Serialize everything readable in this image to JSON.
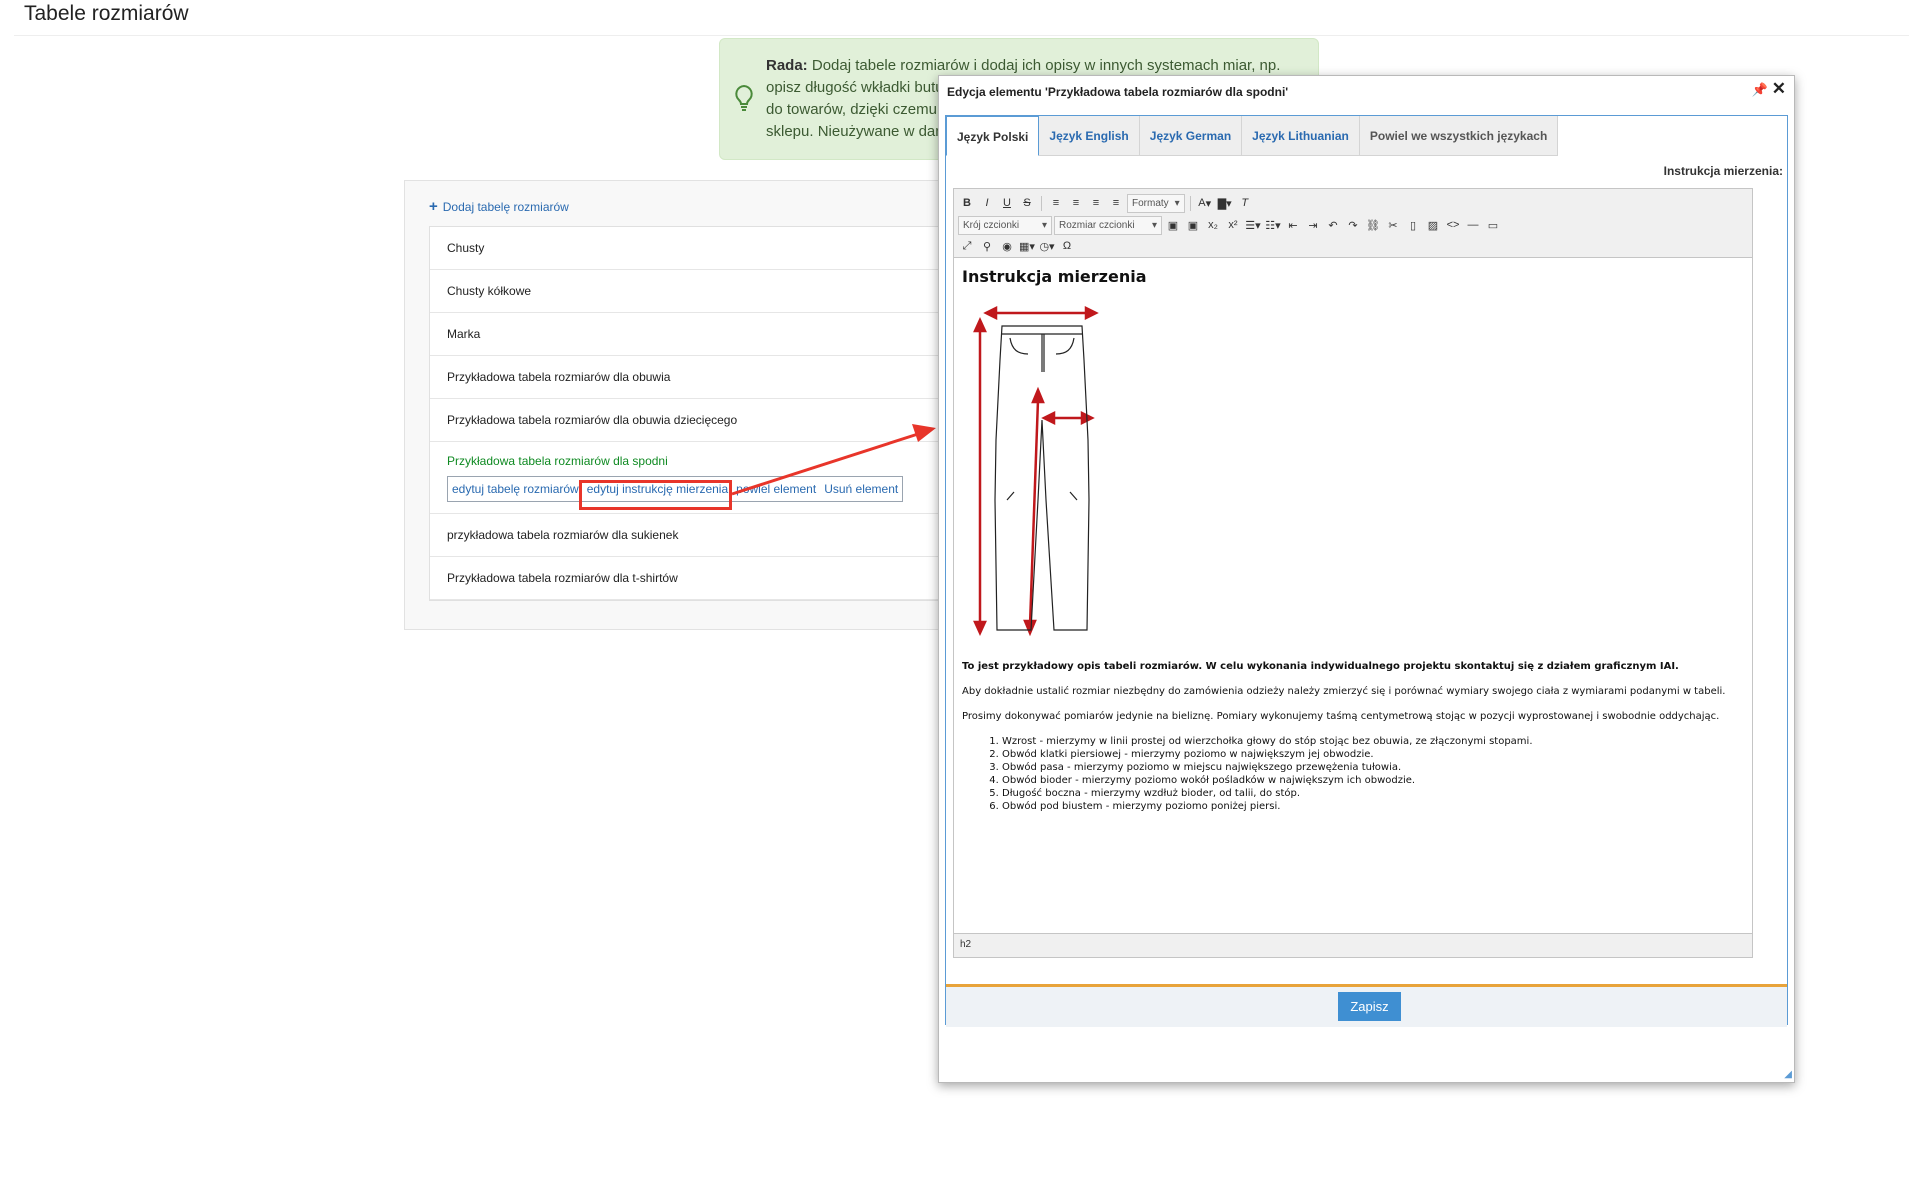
{
  "page": {
    "title": "Tabele rozmiarów"
  },
  "tip": {
    "label": "Rada:",
    "lines": [
      "Dodaj tabele rozmiarów i dodaj ich opisy w innych systemach miar, np.",
      "opisz długość wkładki butu",
      "do towarów, dzięki czemu",
      "sklepu. Nieużywane w dan"
    ]
  },
  "list": {
    "add_label": "Dodaj tabelę rozmiarów",
    "items": [
      "Chusty",
      "Chusty kółkowe",
      "Marka",
      "Przykładowa tabela rozmiarów dla obuwia",
      "Przykładowa tabela rozmiarów dla obuwia dziecięcego",
      "Przykładowa tabela rozmiarów dla spodni",
      "przykładowa tabela rozmiarów dla sukienek",
      "Przykładowa tabela rozmiarów dla t-shirtów"
    ],
    "actions": [
      "edytuj tabelę rozmiarów",
      "edytuj instrukcję mierzenia",
      "powiel element",
      "Usuń element"
    ]
  },
  "modal": {
    "title": "Edycja elementu 'Przykładowa tabela rozmiarów dla spodni'",
    "pin": "📌",
    "close": "✕",
    "tabs": [
      "Język Polski",
      "Język English",
      "Język German",
      "Język Lithuanian",
      "Powiel we wszystkich językach"
    ],
    "field_label": "Instrukcja mierzenia:",
    "save": "Zapisz",
    "status": "h2",
    "toolbar": {
      "row1": [
        "B",
        "I",
        "U",
        "S"
      ],
      "formats": "Formaty",
      "font_family": "Krój czcionki",
      "font_size": "Rozmiar czcionki",
      "color_a": "A",
      "special_char": "Ω"
    },
    "content": {
      "heading": "Instrukcja mierzenia",
      "lead": "To jest przykładowy opis tabeli rozmiarów. W celu wykonania indywidualnego projektu skontaktuj się z działem graficznym IAI.",
      "p1": "Aby dokładnie ustalić rozmiar niezbędny do zamówienia odzieży należy zmierzyć się i porównać wymiary swojego ciała z wymiarami podanymi w tabeli.",
      "p2": "Prosimy dokonywać pomiarów jedynie na bieliznę. Pomiary wykonujemy taśmą centymetrową stojąc w pozycji wyprostowanej i swobodnie oddychając.",
      "steps": [
        "Wzrost - mierzymy w linii prostej od wierzchołka głowy do stóp stojąc bez obuwia, ze złączonymi stopami.",
        "Obwód klatki piersiowej - mierzymy poziomo w największym jej obwodzie.",
        "Obwód pasa - mierzymy poziomo w miejscu największego przewężenia tułowia.",
        "Obwód bioder - mierzymy poziomo wokół pośladków w największym ich obwodzie.",
        "Długość boczna - mierzymy wzdłuż bioder, od talii, do stóp.",
        "Obwód pod biustem - mierzymy poziomo poniżej piersi."
      ]
    }
  },
  "colors": {
    "accent": "#2a6ab0",
    "active_item": "#0f8a22",
    "highlight": "#e8352a",
    "save": "#3f8fd2",
    "tip_bg": "#e1f0d9"
  }
}
